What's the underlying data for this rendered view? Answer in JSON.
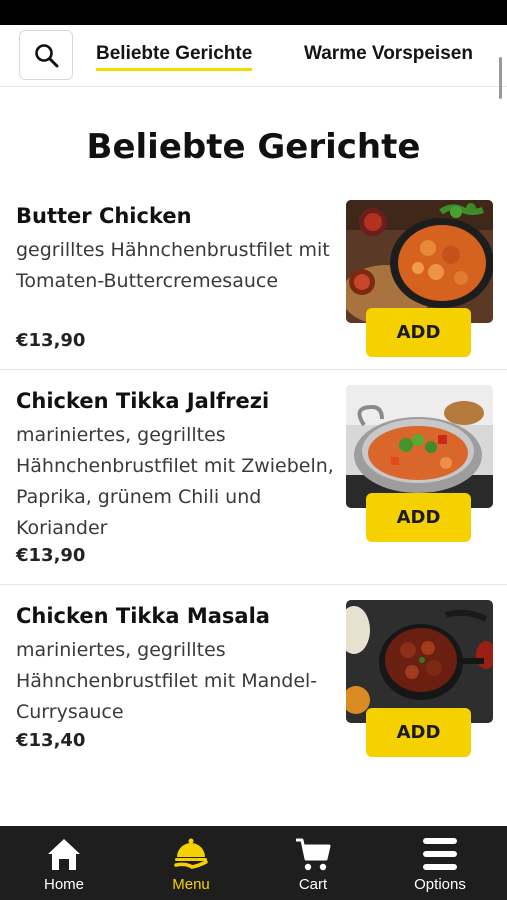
{
  "nav": {
    "tabs": [
      {
        "label": "Beliebte Gerichte",
        "active": true
      },
      {
        "label": "Warme Vorspeisen",
        "active": false
      }
    ],
    "search_icon": "search-icon"
  },
  "section": {
    "title": "Beliebte Gerichte"
  },
  "dishes": [
    {
      "name": "Butter Chicken",
      "description": "gegrilltes Hähnchenbrustfilet mit Tomaten-Buttercremesauce",
      "price": "€13,90",
      "add_label": "ADD",
      "image": "butter-chicken-photo"
    },
    {
      "name": "Chicken Tikka Jalfrezi",
      "description": "mariniertes, gegrilltes Hähnchenbrustfilet mit Zwiebeln, Paprika, grünem Chili und Koriander",
      "price": "€13,90",
      "add_label": "ADD",
      "image": "chicken-tikka-jalfrezi-photo"
    },
    {
      "name": "Chicken Tikka Masala",
      "description": "mariniertes, gegrilltes Hähnchenbrustfilet mit Mandel-Currysauce",
      "price": "€13,40",
      "add_label": "ADD",
      "image": "chicken-tikka-masala-photo"
    }
  ],
  "bottom_nav": {
    "items": [
      {
        "label": "Home",
        "icon": "home-icon",
        "active": false
      },
      {
        "label": "Menu",
        "icon": "serving-cloche-icon",
        "active": true
      },
      {
        "label": "Cart",
        "icon": "cart-icon",
        "active": false
      },
      {
        "label": "Options",
        "icon": "hamburger-menu-icon",
        "active": false
      }
    ]
  },
  "colors": {
    "accent": "#f6d100",
    "bottom_nav_bg": "#1e1e1e",
    "status_bar": "#000000"
  }
}
